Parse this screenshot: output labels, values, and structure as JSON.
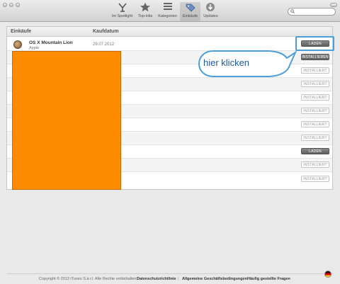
{
  "toolbar": {
    "nav": [
      {
        "label": "Im Spotlight",
        "icon": "spotlight-icon"
      },
      {
        "label": "Top-Hits",
        "icon": "star-icon"
      },
      {
        "label": "Kategorien",
        "icon": "categories-icon"
      },
      {
        "label": "Einkäufe",
        "icon": "purchases-icon",
        "active": true
      },
      {
        "label": "Updates",
        "icon": "updates-icon"
      }
    ],
    "search": {
      "placeholder": "",
      "value": ""
    }
  },
  "list": {
    "headers": {
      "name": "Einkäufe",
      "date": "Kaufdatum"
    },
    "rows": [
      {
        "name": "OS X Mountain Lion",
        "developer": "Apple",
        "date": "29.07.2012",
        "button": "LADEN",
        "style": "dark"
      },
      {
        "button": "INSTALLIEREN",
        "style": "dark"
      },
      {
        "button": "INSTALLIERT",
        "style": "light"
      },
      {
        "button": "INSTALLIERT",
        "style": "light"
      },
      {
        "button": "INSTALLIERT",
        "style": "light"
      },
      {
        "button": "INSTALLIERT",
        "style": "light"
      },
      {
        "button": "INSTALLIERT",
        "style": "light"
      },
      {
        "button": "INSTALLIERT",
        "style": "light"
      },
      {
        "button": "LADEN",
        "style": "dark"
      },
      {
        "button": "INSTALLIERT",
        "style": "light"
      },
      {
        "button": "INSTALLIERT",
        "style": "light"
      }
    ]
  },
  "annotation": {
    "callout": "hier klicken",
    "color": "#4a9fdc"
  },
  "redaction_color": "#ff8c00",
  "footer": {
    "copyright": "Copyright © 2012 iTunes S.à r.l. Alle Rechte vorbehalten.",
    "links": [
      "Datenschutzrichtlinie",
      "Allgemeine Geschäftsbedingungen",
      "Häufig gestellte Fragen"
    ],
    "separator": "|"
  }
}
